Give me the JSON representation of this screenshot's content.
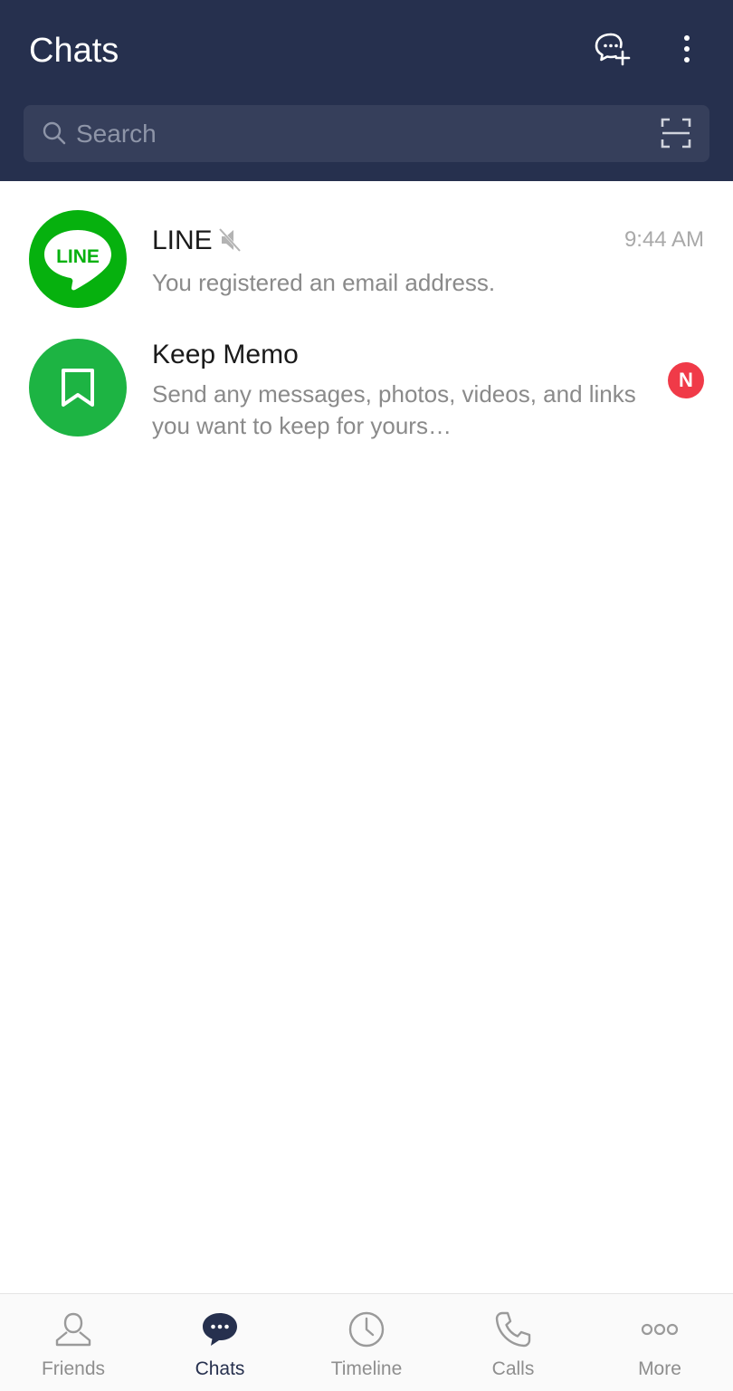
{
  "header": {
    "title": "Chats",
    "background_color": "#26304e",
    "new_chat_icon": "chat-add-icon",
    "menu_icon": "more-vertical-icon"
  },
  "search": {
    "placeholder": "Search",
    "value": "",
    "scan_icon": "qr-scan-icon"
  },
  "chats": [
    {
      "name": "LINE",
      "avatar_text": "LINE",
      "muted": true,
      "time": "9:44 AM",
      "preview": "You registered an email address."
    },
    {
      "name": "Keep Memo",
      "avatar_icon": "bookmark-icon",
      "badge": "N",
      "preview": "Send any messages, photos, videos, and links you want to keep for yours…"
    }
  ],
  "bottom_nav": {
    "active": "Chats",
    "items": [
      {
        "label": "Friends",
        "icon": "person-icon"
      },
      {
        "label": "Chats",
        "icon": "chat-bubble-icon"
      },
      {
        "label": "Timeline",
        "icon": "clock-icon"
      },
      {
        "label": "Calls",
        "icon": "phone-icon"
      },
      {
        "label": "More",
        "icon": "more-horizontal-icon"
      }
    ]
  },
  "colors": {
    "line_green": "#06b10e",
    "memo_green": "#1db443",
    "badge_red": "#f03a48",
    "active_nav": "#26304e"
  }
}
